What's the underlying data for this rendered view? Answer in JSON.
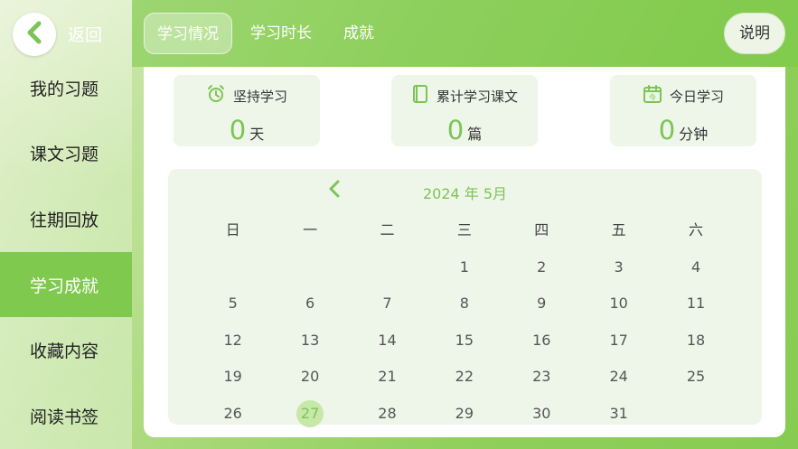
{
  "sidebar": {
    "back_label": "返回",
    "items": [
      {
        "label": "我的习题"
      },
      {
        "label": "课文习题"
      },
      {
        "label": "往期回放"
      },
      {
        "label": "学习成就",
        "active": true
      },
      {
        "label": "收藏内容"
      },
      {
        "label": "阅读书签"
      }
    ]
  },
  "tabs": [
    {
      "label": "学习情况",
      "active": true
    },
    {
      "label": "学习时长"
    },
    {
      "label": "成就"
    }
  ],
  "help_label": "说明",
  "stats": [
    {
      "icon": "alarm-clock-icon",
      "label": "坚持学习",
      "value": "0",
      "unit": "天"
    },
    {
      "icon": "book-icon",
      "label": "累计学习课文",
      "value": "0",
      "unit": "篇"
    },
    {
      "icon": "calendar-today-icon",
      "label": "今日学习",
      "value": "0",
      "unit": "分钟"
    }
  ],
  "calendar": {
    "title": "2024 年 5月",
    "weekdays": [
      "日",
      "一",
      "二",
      "三",
      "四",
      "五",
      "六"
    ],
    "weeks": [
      [
        "",
        "",
        "",
        "1",
        "2",
        "3",
        "4"
      ],
      [
        "5",
        "6",
        "7",
        "8",
        "9",
        "10",
        "11"
      ],
      [
        "12",
        "13",
        "14",
        "15",
        "16",
        "17",
        "18"
      ],
      [
        "19",
        "20",
        "21",
        "22",
        "23",
        "24",
        "25"
      ],
      [
        "26",
        "27",
        "28",
        "29",
        "30",
        "31",
        ""
      ]
    ],
    "today": "27"
  },
  "colors": {
    "accent": "#7cc455",
    "sidebar_active": "#80c94f",
    "card_bg": "#eef6e9"
  }
}
